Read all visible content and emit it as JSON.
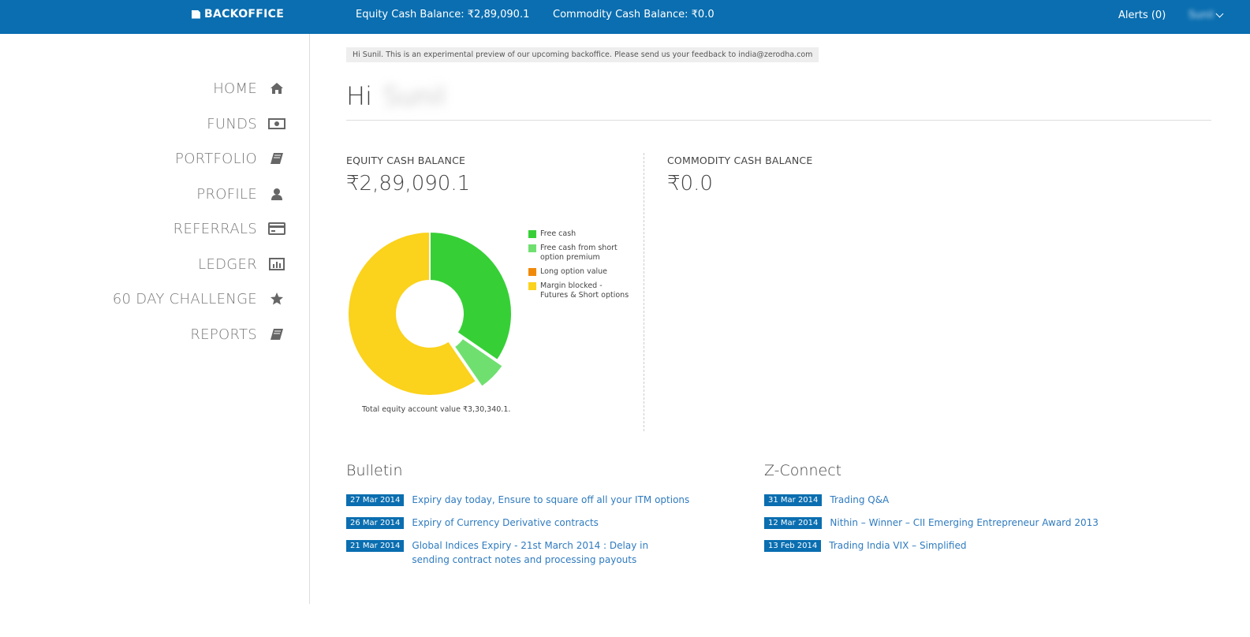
{
  "topbar": {
    "logo": "BACKOFFICE",
    "equity_balance": "Equity Cash Balance: ₹2,89,090.1",
    "commodity_balance": "Commodity Cash Balance: ₹0.0",
    "alerts": "Alerts (0)",
    "user_name": "Sunil"
  },
  "sidebar": {
    "items": [
      {
        "label": "HOME",
        "icon": "home-icon"
      },
      {
        "label": "FUNDS",
        "icon": "money-icon"
      },
      {
        "label": "PORTFOLIO",
        "icon": "book-icon"
      },
      {
        "label": "PROFILE",
        "icon": "user-icon"
      },
      {
        "label": "REFERRALS",
        "icon": "credit-card-icon"
      },
      {
        "label": "LEDGER",
        "icon": "bar-chart-icon"
      },
      {
        "label": "60 DAY CHALLENGE",
        "icon": "star-icon"
      },
      {
        "label": "REPORTS",
        "icon": "book-icon"
      }
    ]
  },
  "main": {
    "notice": "Hi Sunil. This is an experimental preview of our upcoming backoffice. Please send us your feedback to india@zerodha.com",
    "greeting": "Hi",
    "greeting_name": "Sunil",
    "equity": {
      "title": "EQUITY CASH BALANCE",
      "value": "₹2,89,090.1"
    },
    "commodity": {
      "title": "COMMODITY CASH BALANCE",
      "value": "₹0.0"
    },
    "chart_caption": "Total equity account value ₹3,30,340.1."
  },
  "chart_data": {
    "type": "pie",
    "categories": [
      "Free cash",
      "Free cash from short option premium",
      "Long option value",
      "Margin blocked - Futures & Short options"
    ],
    "legend_labels": [
      "Free cash",
      "Free cash from short option premium",
      "Long option value",
      "Margin blocked - Futures & Short options"
    ],
    "values": [
      34.6,
      5.8,
      0,
      59.6
    ],
    "colors": [
      "#36d036",
      "#6fe06f",
      "#f08a0b",
      "#fbd21c"
    ],
    "donut": true,
    "exploded_slice": 1,
    "legend_position": "right"
  },
  "bulletin": {
    "title": "Bulletin",
    "items": [
      {
        "date": "27 Mar 2014",
        "text": "Expiry day today, Ensure to square off all your ITM options"
      },
      {
        "date": "26 Mar 2014",
        "text": "Expiry of Currency Derivative contracts"
      },
      {
        "date": "21 Mar 2014",
        "text": "Global Indices Expiry - 21st March 2014 : Delay in sending contract notes and processing payouts"
      }
    ]
  },
  "zconnect": {
    "title": "Z-Connect",
    "items": [
      {
        "date": "31 Mar 2014",
        "text": "Trading Q&A"
      },
      {
        "date": "12 Mar 2014",
        "text": "Nithin – Winner – CII Emerging Entrepreneur Award 2013"
      },
      {
        "date": "13 Feb 2014",
        "text": "Trading India VIX – Simplified"
      }
    ]
  }
}
